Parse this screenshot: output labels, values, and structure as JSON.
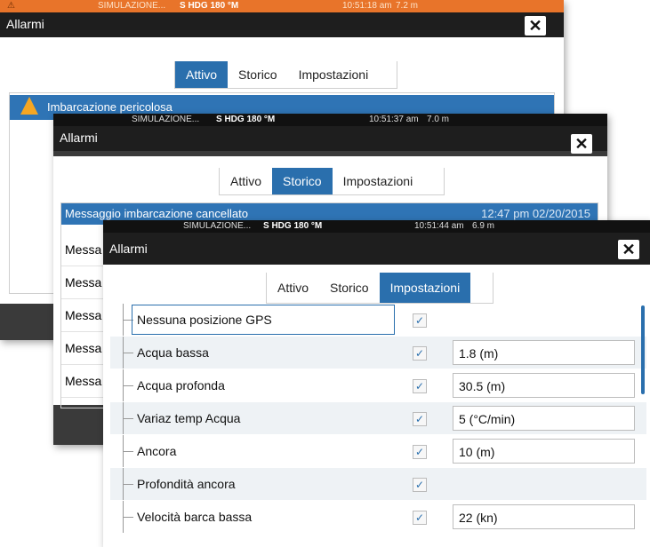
{
  "win1": {
    "status_sim": "SIMULAZIONE...",
    "status_hdg": "S HDG 180 °M",
    "status_time": "10:51:18 am",
    "status_depth": "7.2 m",
    "title": "Allarmi",
    "close": "✕",
    "tabs": [
      "Attivo",
      "Storico",
      "Impostazioni"
    ],
    "alarm_text": "Imbarcazione pericolosa",
    "warning_icon": "warning-triangle-icon"
  },
  "win2": {
    "status_sim": "SIMULAZIONE...",
    "status_hdg": "S HDG 180 °M",
    "status_time": "10:51:37 am",
    "status_depth": "7.0 m",
    "title": "Allarmi",
    "close": "✕",
    "tabs": [
      "Attivo",
      "Storico",
      "Impostazioni"
    ],
    "history_first": "Messaggio imbarcazione cancellato",
    "history_first_time": "12:47 pm 02/20/2015",
    "history_rows": [
      "Messa",
      "Messa",
      "Messa",
      "Messa",
      "Messa"
    ]
  },
  "win3": {
    "status_sim": "SIMULAZIONE...",
    "status_hdg": "S HDG 180 °M",
    "status_time": "10:51:44 am",
    "status_depth": "6.9 m",
    "title": "Allarmi",
    "close": "✕",
    "tabs": [
      "Attivo",
      "Storico",
      "Impostazioni"
    ],
    "settings": [
      {
        "label": "Nessuna posizione GPS",
        "checked": "✓",
        "value": ""
      },
      {
        "label": "Acqua bassa",
        "checked": "✓",
        "value": "1.8 (m)"
      },
      {
        "label": "Acqua profonda",
        "checked": "✓",
        "value": "30.5 (m)"
      },
      {
        "label": "Variaz temp Acqua",
        "checked": "✓",
        "value": "5 (°C/min)"
      },
      {
        "label": "Ancora",
        "checked": "✓",
        "value": "10 (m)"
      },
      {
        "label": "Profondità ancora",
        "checked": "✓",
        "value": ""
      },
      {
        "label": "Velocità barca bassa",
        "checked": "✓",
        "value": "22 (kn)"
      }
    ]
  },
  "colors": {
    "accent": "#2a6fad",
    "titlebar": "#1e1e1e",
    "status_orange": "#e8742a"
  }
}
